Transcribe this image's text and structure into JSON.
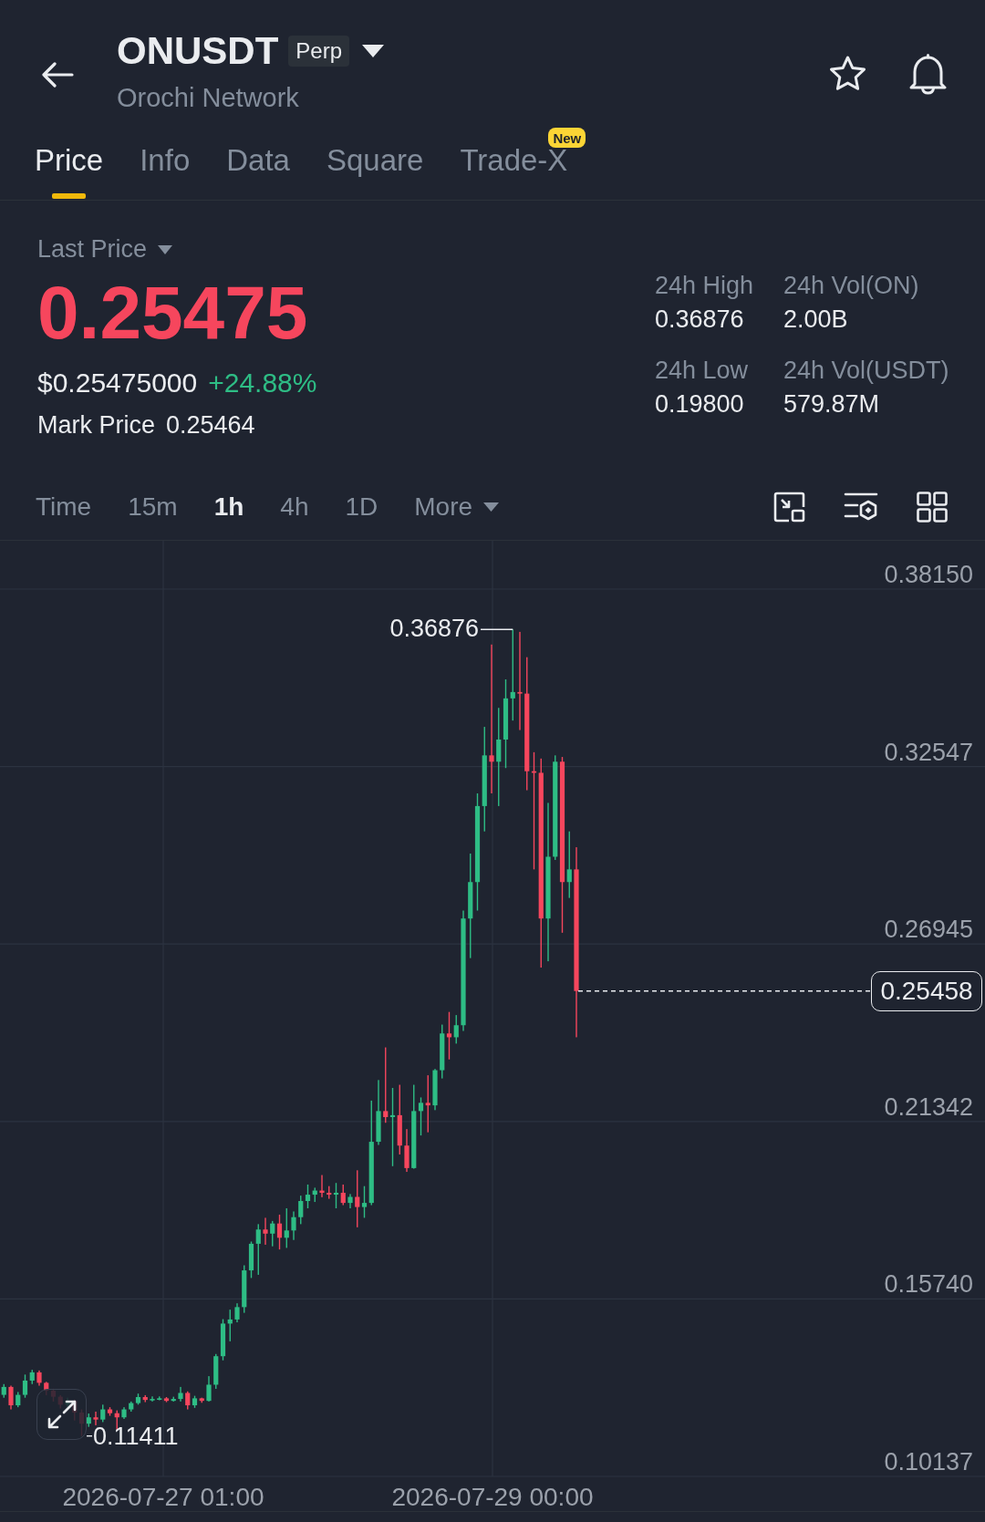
{
  "header": {
    "symbol": "ONUSDT",
    "contract_badge": "Perp",
    "name": "Orochi Network"
  },
  "tabs": [
    {
      "label": "Price",
      "selected": true
    },
    {
      "label": "Info",
      "selected": false
    },
    {
      "label": "Data",
      "selected": false
    },
    {
      "label": "Square",
      "selected": false
    },
    {
      "label": "Trade-X",
      "selected": false,
      "badge": "New"
    }
  ],
  "price_panel": {
    "price_type": "Last Price",
    "last_price": "0.25475",
    "usd_price": "$0.25475000",
    "change": "+24.88%",
    "mark_price_label": "Mark Price",
    "mark_price": "0.25464"
  },
  "stats": [
    {
      "label": "24h High",
      "value": "0.36876"
    },
    {
      "label": "24h Vol(ON)",
      "value": "2.00B"
    },
    {
      "label": "24h Low",
      "value": "0.19800"
    },
    {
      "label": "24h Vol(USDT)",
      "value": "579.87M"
    }
  ],
  "intervals": [
    {
      "label": "Time",
      "selected": false
    },
    {
      "label": "15m",
      "selected": false
    },
    {
      "label": "1h",
      "selected": true
    },
    {
      "label": "4h",
      "selected": false
    },
    {
      "label": "1D",
      "selected": false
    },
    {
      "label": "More",
      "selected": false,
      "dropdown": true
    }
  ],
  "chart": {
    "y_axis_labels": [
      "0.38150",
      "0.32547",
      "0.26945",
      "0.21342",
      "0.15740",
      "0.10137"
    ],
    "x_axis_labels": [
      "2026-07-27 01:00",
      "2026-07-29 00:00"
    ],
    "high_label": "0.36876",
    "low_label": "0.11411",
    "current_price": "0.25458"
  }
}
